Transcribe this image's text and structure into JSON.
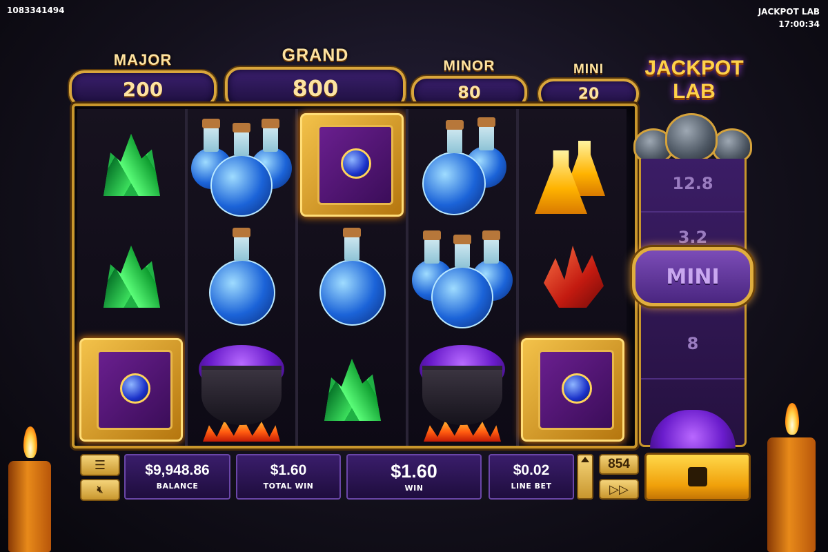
{
  "session_id": "1083341494",
  "game_title": "JACKPOT LAB",
  "clock": "17:00:34",
  "logo_text": [
    "JACKPOT",
    "LAB"
  ],
  "jackpots": {
    "major": {
      "label": "MAJOR",
      "value": "200"
    },
    "grand": {
      "label": "GRAND",
      "value": "800"
    },
    "minor": {
      "label": "MINOR",
      "value": "80"
    },
    "mini": {
      "label": "MINI",
      "value": "20"
    }
  },
  "reels": [
    [
      "green-crystal",
      "green-crystal",
      "spell-book"
    ],
    [
      "blue-potion-triple",
      "blue-potion",
      "purple-cauldron"
    ],
    [
      "spell-book",
      "blue-potion",
      "green-crystal"
    ],
    [
      "blue-potion-double",
      "blue-potion-triple",
      "purple-cauldron"
    ],
    [
      "yellow-potion-double",
      "red-crystal",
      "spell-book"
    ]
  ],
  "side_meter": {
    "values": [
      "12.8",
      "3.2",
      "MINI",
      "8"
    ],
    "highlighted": "MINI"
  },
  "bottom": {
    "balance": {
      "value": "$9,948.86",
      "label": "BALANCE"
    },
    "total_win": {
      "value": "$1.60",
      "label": "TOTAL WIN"
    },
    "win": {
      "value": "$1.60",
      "label": "WIN"
    },
    "line_bet": {
      "value": "$0.02",
      "label": "LINE BET"
    },
    "spins_count": "854",
    "menu_icon": "menu-icon",
    "sound_icon": "mute-icon",
    "ffwd_icon": "fast-forward-icon",
    "stop_icon": "stop-icon"
  },
  "colors": {
    "gold": "#c8962c",
    "purple_panel": "#3a1d6b",
    "spin_button": "#f0a00a"
  }
}
